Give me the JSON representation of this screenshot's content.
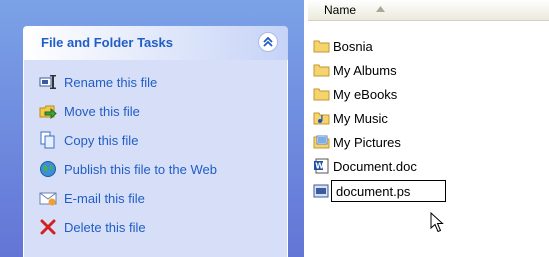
{
  "task_pane": {
    "title": "File and Folder Tasks",
    "tasks": [
      {
        "label": "Rename this file",
        "icon": "rename-icon"
      },
      {
        "label": "Move this file",
        "icon": "move-icon"
      },
      {
        "label": "Copy this file",
        "icon": "copy-icon"
      },
      {
        "label": "Publish this file to the Web",
        "icon": "publish-web-icon"
      },
      {
        "label": "E-mail this file",
        "icon": "email-icon"
      },
      {
        "label": "Delete this file",
        "icon": "delete-icon"
      }
    ]
  },
  "file_list": {
    "column_header": "Name",
    "items": [
      {
        "label": "Bosnia",
        "icon": "folder-icon"
      },
      {
        "label": "My Albums",
        "icon": "folder-icon"
      },
      {
        "label": "My eBooks",
        "icon": "folder-icon"
      },
      {
        "label": "My Music",
        "icon": "music-folder-icon"
      },
      {
        "label": "My Pictures",
        "icon": "pictures-folder-icon"
      },
      {
        "label": "Document.doc",
        "icon": "word-document-icon"
      }
    ],
    "renaming_item": {
      "icon": "ps-file-icon",
      "value": "document.ps"
    }
  },
  "colors": {
    "task_link": "#215dc6",
    "pane_background": "#6375d6",
    "panel_body": "#d6dff7"
  }
}
